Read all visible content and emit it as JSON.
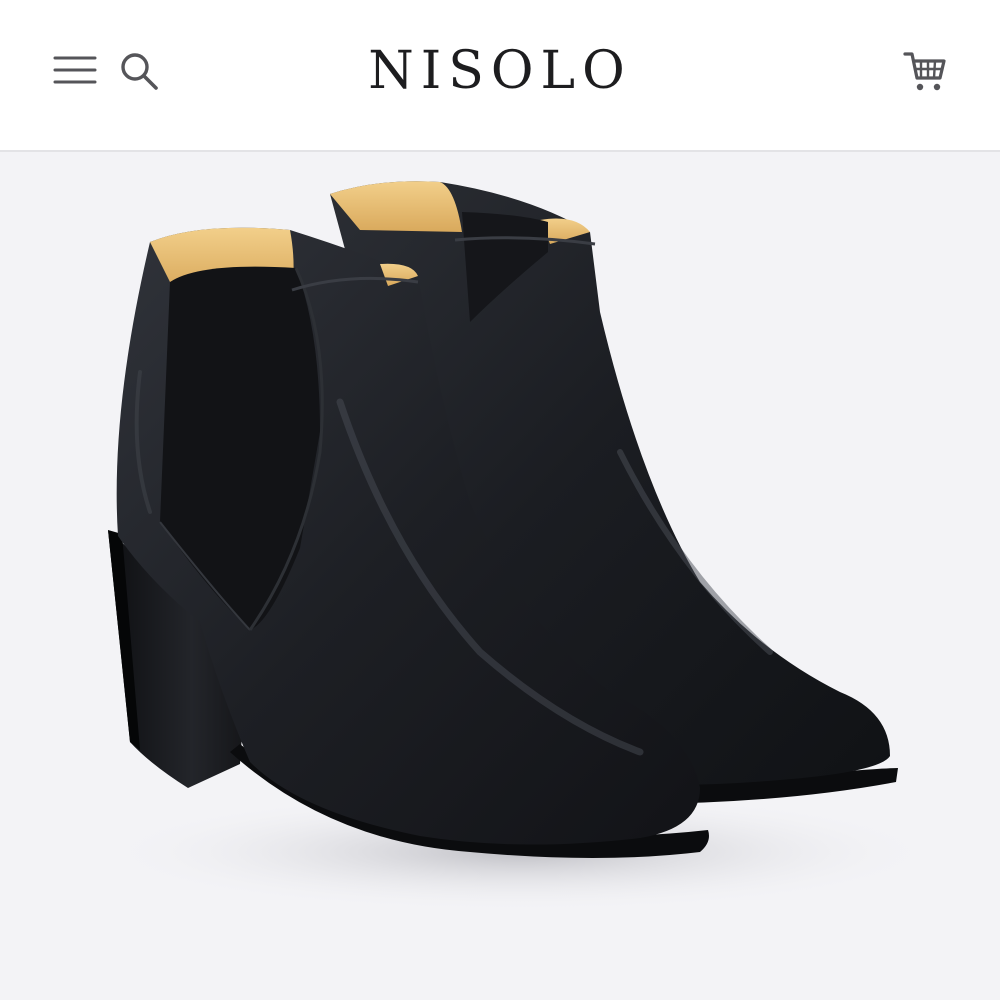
{
  "header": {
    "brand": "NISOLO",
    "menu_icon": "hamburger-menu-icon",
    "search_icon": "search-icon",
    "cart_icon": "shopping-cart-icon"
  },
  "hero": {
    "image": "black-leather-chelsea-heeled-boots-photo"
  },
  "colors": {
    "header_bg": "#ffffff",
    "hero_bg": "#f3f3f6",
    "text": "#1d1d1f",
    "icon": "#555559"
  }
}
